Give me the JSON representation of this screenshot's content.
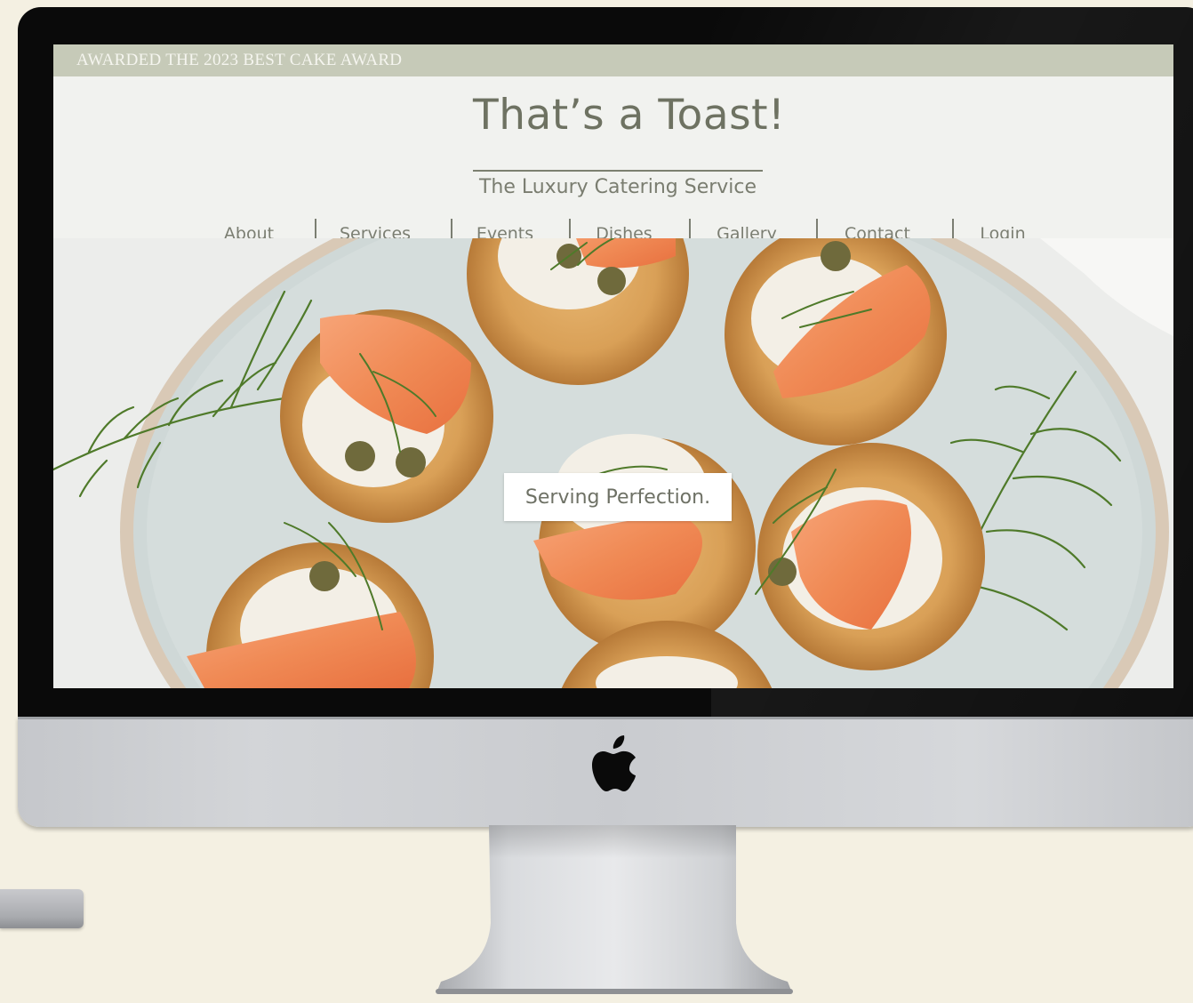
{
  "promo": {
    "text": "AWARDED THE 2023 BEST CAKE AWARD"
  },
  "brand": {
    "title": "That’s a Toast!",
    "tagline": "The Luxury Catering Service"
  },
  "nav": {
    "items": [
      {
        "label": "About"
      },
      {
        "label": "Services"
      },
      {
        "label": "Events"
      },
      {
        "label": "Dishes"
      },
      {
        "label": "Gallery"
      },
      {
        "label": "Contact"
      },
      {
        "label": "Login"
      }
    ]
  },
  "hero": {
    "caption": "Serving Perfection.",
    "image_subject": "smoked salmon crostini with cream cheese, capers and dill on a plate"
  },
  "device": {
    "logo": "apple-icon"
  },
  "colors": {
    "promo_bar": "#c6cab8",
    "brand_text": "#6e7262",
    "nav_text": "#7b7e72",
    "page_bg": "#f1f2ef",
    "desk": "#f4f0e2"
  }
}
